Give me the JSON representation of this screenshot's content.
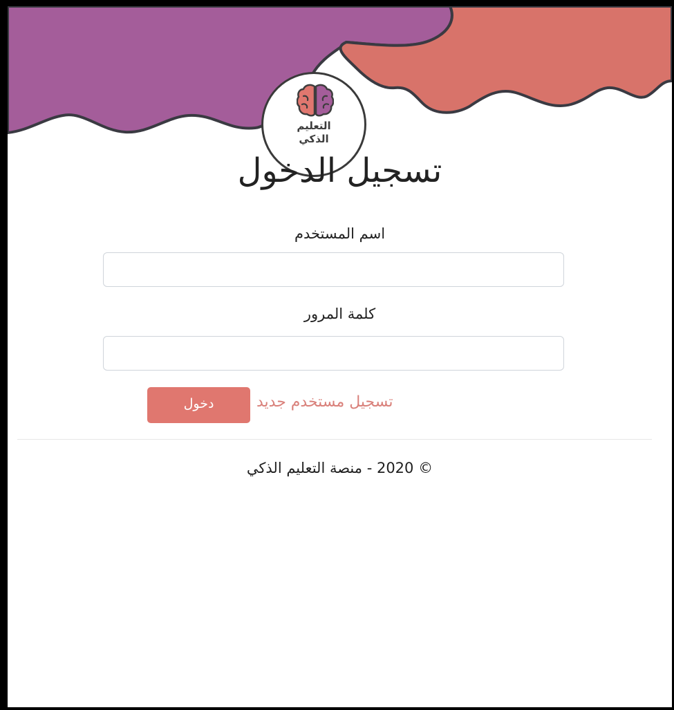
{
  "logo": {
    "line1": "التعليم",
    "line2": "الذكي",
    "icon": "brain-icon"
  },
  "page": {
    "title": "تسجيل الدخول"
  },
  "form": {
    "username_label": "اسم المستخدم",
    "username_value": "",
    "password_label": "كلمة المرور",
    "password_value": "",
    "login_button": "دخول",
    "register_link": "تسجيل مستخدم جديد"
  },
  "footer": {
    "text": "© 2020 - منصة التعليم الذكي"
  },
  "colors": {
    "purple_cloud": "#a45d9a",
    "coral_cloud": "#d8736a",
    "cloud_outline": "#3a3a42",
    "button": "#e0776f",
    "link": "#d9807a"
  }
}
